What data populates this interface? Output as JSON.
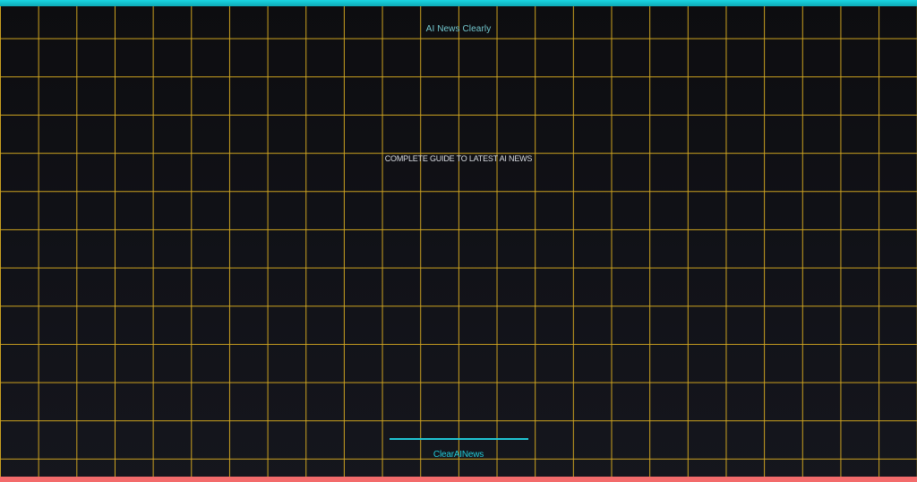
{
  "brand_name": "AI News Clearly",
  "headline": "COMPLETE GUIDE TO LATEST AI NEWS",
  "footer_link": "ClearAINews",
  "colors": {
    "top_bar": "#19d6e3",
    "bottom_bar": "#f36b6b",
    "grid": "#d0a520",
    "background": "#111218",
    "brand_text": "#74c9cf",
    "accent": "#20c7d6"
  }
}
